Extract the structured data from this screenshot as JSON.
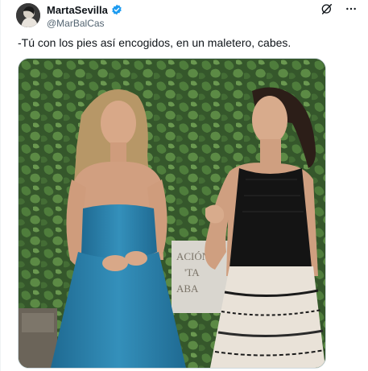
{
  "author": {
    "display_name": "MartaSevilla",
    "handle": "@MarBalCas",
    "verified": true,
    "avatar_icon": "profile-photo"
  },
  "actions": {
    "grok_icon": "grok-icon",
    "more_icon": "more-horizontal-icon"
  },
  "tweet": {
    "text": "-Tú con los pies así encogidos, en un maletero, cabes."
  },
  "media": {
    "sign_text": "ACIÓN\nTA\nABA",
    "sign_line1": "ACIÓN",
    "sign_line2": "'TA",
    "sign_line3": "ABA"
  },
  "colors": {
    "verified_blue": "#1d9bf0",
    "handle_gray": "#536471",
    "text": "#0f1419",
    "ivy_green": "#3f6a32",
    "dress_teal": "#2b7fa8",
    "dress_black": "#141414"
  }
}
